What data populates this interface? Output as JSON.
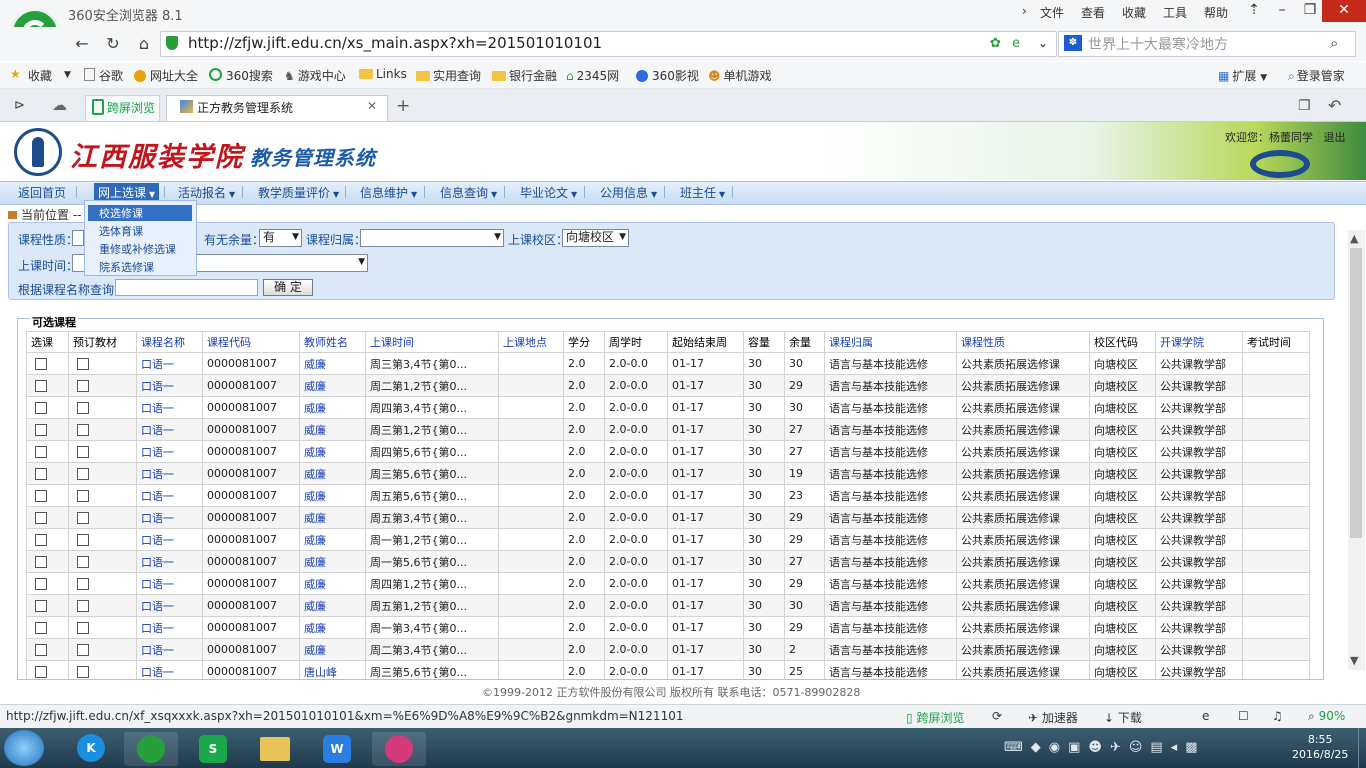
{
  "browser": {
    "title": "360安全浏览器 8.1",
    "menu": [
      "文件",
      "查看",
      "收藏",
      "工具",
      "帮助"
    ],
    "url": "http://zfjw.jift.edu.cn/xs_main.aspx?xh=201501010101",
    "search_placeholder": "世界上十大最寒冷地方",
    "bookmarks": [
      "收藏",
      "谷歌",
      "网址大全",
      "360搜索",
      "游戏中心",
      "Links",
      "实用查询",
      "银行金融",
      "2345网",
      "360影视",
      "单机游戏"
    ],
    "bookmarks_right": [
      "扩展",
      "登录管家"
    ],
    "tabs": {
      "split": "跨屏浏览",
      "active": "正方教务管理系统"
    }
  },
  "page": {
    "school_name": "江西服装学院",
    "system_name": "教务管理系统",
    "welcome": "欢迎您：杨蕾同学",
    "logout": "退出",
    "nav": [
      "返回首页",
      "网上选课",
      "活动报名",
      "教学质量评价",
      "信息维护",
      "信息查询",
      "毕业论文",
      "公用信息",
      "班主任"
    ],
    "location": "当前位置 --",
    "dropdown": [
      "校选修课",
      "选体育课",
      "重修或补修选课",
      "院系选修课"
    ],
    "filters": {
      "course_type": "课程性质：",
      "has_remaining": "有无余量：",
      "has_remaining_value": "有",
      "course_belong": "课程归属：",
      "campus": "上课校区：",
      "campus_value": "向塘校区",
      "class_time": "上课时间：",
      "search_by_name": "根据课程名称查询：",
      "ok": "确 定"
    },
    "result_title": "可选课程",
    "columns": [
      "选课",
      "预订教材",
      "课程名称",
      "课程代码",
      "教师姓名",
      "上课时间",
      "上课地点",
      "学分",
      "周学时",
      "起始结束周",
      "容量",
      "余量",
      "课程归属",
      "课程性质",
      "校区代码",
      "开课学院",
      "考试时间"
    ],
    "rows": [
      {
        "name": "口语一",
        "code": "0000081007",
        "teacher": "威廉",
        "time": "周三第3,4节{第0...",
        "credit": "2.0",
        "hours": "2.0-0.0",
        "weeks": "01-17",
        "cap": "30",
        "left": "30",
        "belong": "语言与基本技能选修",
        "nature": "公共素质拓展选修课",
        "campus": "向塘校区",
        "college": "公共课教学部"
      },
      {
        "name": "口语一",
        "code": "0000081007",
        "teacher": "威廉",
        "time": "周二第1,2节{第0...",
        "credit": "2.0",
        "hours": "2.0-0.0",
        "weeks": "01-17",
        "cap": "30",
        "left": "29",
        "belong": "语言与基本技能选修",
        "nature": "公共素质拓展选修课",
        "campus": "向塘校区",
        "college": "公共课教学部"
      },
      {
        "name": "口语一",
        "code": "0000081007",
        "teacher": "威廉",
        "time": "周四第3,4节{第0...",
        "credit": "2.0",
        "hours": "2.0-0.0",
        "weeks": "01-17",
        "cap": "30",
        "left": "30",
        "belong": "语言与基本技能选修",
        "nature": "公共素质拓展选修课",
        "campus": "向塘校区",
        "college": "公共课教学部"
      },
      {
        "name": "口语一",
        "code": "0000081007",
        "teacher": "威廉",
        "time": "周三第1,2节{第0...",
        "credit": "2.0",
        "hours": "2.0-0.0",
        "weeks": "01-17",
        "cap": "30",
        "left": "27",
        "belong": "语言与基本技能选修",
        "nature": "公共素质拓展选修课",
        "campus": "向塘校区",
        "college": "公共课教学部"
      },
      {
        "name": "口语一",
        "code": "0000081007",
        "teacher": "威廉",
        "time": "周四第5,6节{第0...",
        "credit": "2.0",
        "hours": "2.0-0.0",
        "weeks": "01-17",
        "cap": "30",
        "left": "27",
        "belong": "语言与基本技能选修",
        "nature": "公共素质拓展选修课",
        "campus": "向塘校区",
        "college": "公共课教学部"
      },
      {
        "name": "口语一",
        "code": "0000081007",
        "teacher": "威廉",
        "time": "周三第5,6节{第0...",
        "credit": "2.0",
        "hours": "2.0-0.0",
        "weeks": "01-17",
        "cap": "30",
        "left": "19",
        "belong": "语言与基本技能选修",
        "nature": "公共素质拓展选修课",
        "campus": "向塘校区",
        "college": "公共课教学部"
      },
      {
        "name": "口语一",
        "code": "0000081007",
        "teacher": "威廉",
        "time": "周五第5,6节{第0...",
        "credit": "2.0",
        "hours": "2.0-0.0",
        "weeks": "01-17",
        "cap": "30",
        "left": "23",
        "belong": "语言与基本技能选修",
        "nature": "公共素质拓展选修课",
        "campus": "向塘校区",
        "college": "公共课教学部"
      },
      {
        "name": "口语一",
        "code": "0000081007",
        "teacher": "威廉",
        "time": "周五第3,4节{第0...",
        "credit": "2.0",
        "hours": "2.0-0.0",
        "weeks": "01-17",
        "cap": "30",
        "left": "29",
        "belong": "语言与基本技能选修",
        "nature": "公共素质拓展选修课",
        "campus": "向塘校区",
        "college": "公共课教学部"
      },
      {
        "name": "口语一",
        "code": "0000081007",
        "teacher": "威廉",
        "time": "周一第1,2节{第0...",
        "credit": "2.0",
        "hours": "2.0-0.0",
        "weeks": "01-17",
        "cap": "30",
        "left": "29",
        "belong": "语言与基本技能选修",
        "nature": "公共素质拓展选修课",
        "campus": "向塘校区",
        "college": "公共课教学部"
      },
      {
        "name": "口语一",
        "code": "0000081007",
        "teacher": "威廉",
        "time": "周一第5,6节{第0...",
        "credit": "2.0",
        "hours": "2.0-0.0",
        "weeks": "01-17",
        "cap": "30",
        "left": "27",
        "belong": "语言与基本技能选修",
        "nature": "公共素质拓展选修课",
        "campus": "向塘校区",
        "college": "公共课教学部"
      },
      {
        "name": "口语一",
        "code": "0000081007",
        "teacher": "威廉",
        "time": "周四第1,2节{第0...",
        "credit": "2.0",
        "hours": "2.0-0.0",
        "weeks": "01-17",
        "cap": "30",
        "left": "29",
        "belong": "语言与基本技能选修",
        "nature": "公共素质拓展选修课",
        "campus": "向塘校区",
        "college": "公共课教学部"
      },
      {
        "name": "口语一",
        "code": "0000081007",
        "teacher": "威廉",
        "time": "周五第1,2节{第0...",
        "credit": "2.0",
        "hours": "2.0-0.0",
        "weeks": "01-17",
        "cap": "30",
        "left": "30",
        "belong": "语言与基本技能选修",
        "nature": "公共素质拓展选修课",
        "campus": "向塘校区",
        "college": "公共课教学部"
      },
      {
        "name": "口语一",
        "code": "0000081007",
        "teacher": "威廉",
        "time": "周一第3,4节{第0...",
        "credit": "2.0",
        "hours": "2.0-0.0",
        "weeks": "01-17",
        "cap": "30",
        "left": "29",
        "belong": "语言与基本技能选修",
        "nature": "公共素质拓展选修课",
        "campus": "向塘校区",
        "college": "公共课教学部"
      },
      {
        "name": "口语一",
        "code": "0000081007",
        "teacher": "威廉",
        "time": "周二第3,4节{第0...",
        "credit": "2.0",
        "hours": "2.0-0.0",
        "weeks": "01-17",
        "cap": "30",
        "left": "2",
        "belong": "语言与基本技能选修",
        "nature": "公共素质拓展选修课",
        "campus": "向塘校区",
        "college": "公共课教学部"
      },
      {
        "name": "口语一",
        "code": "0000081007",
        "teacher": "唐山峰",
        "time": "周三第5,6节{第0...",
        "credit": "2.0",
        "hours": "2.0-0.0",
        "weeks": "01-17",
        "cap": "30",
        "left": "25",
        "belong": "语言与基本技能选修",
        "nature": "公共素质拓展选修课",
        "campus": "向塘校区",
        "college": "公共课教学部"
      }
    ],
    "footer": "©1999-2012  正方软件股份有限公司 版权所有  联系电话：0571-89902828"
  },
  "status": {
    "url": "http://zfjw.jift.edu.cn/xf_xsqxxxk.aspx?xh=201501010101&xm=%E6%9D%A8%E9%9C%B2&gnmkdm=N121101",
    "items": [
      "跨屏浏览",
      "加速器",
      "下载"
    ],
    "zoom": "90%"
  },
  "taskbar": {
    "time": "8:55",
    "date": "2016/8/25"
  }
}
